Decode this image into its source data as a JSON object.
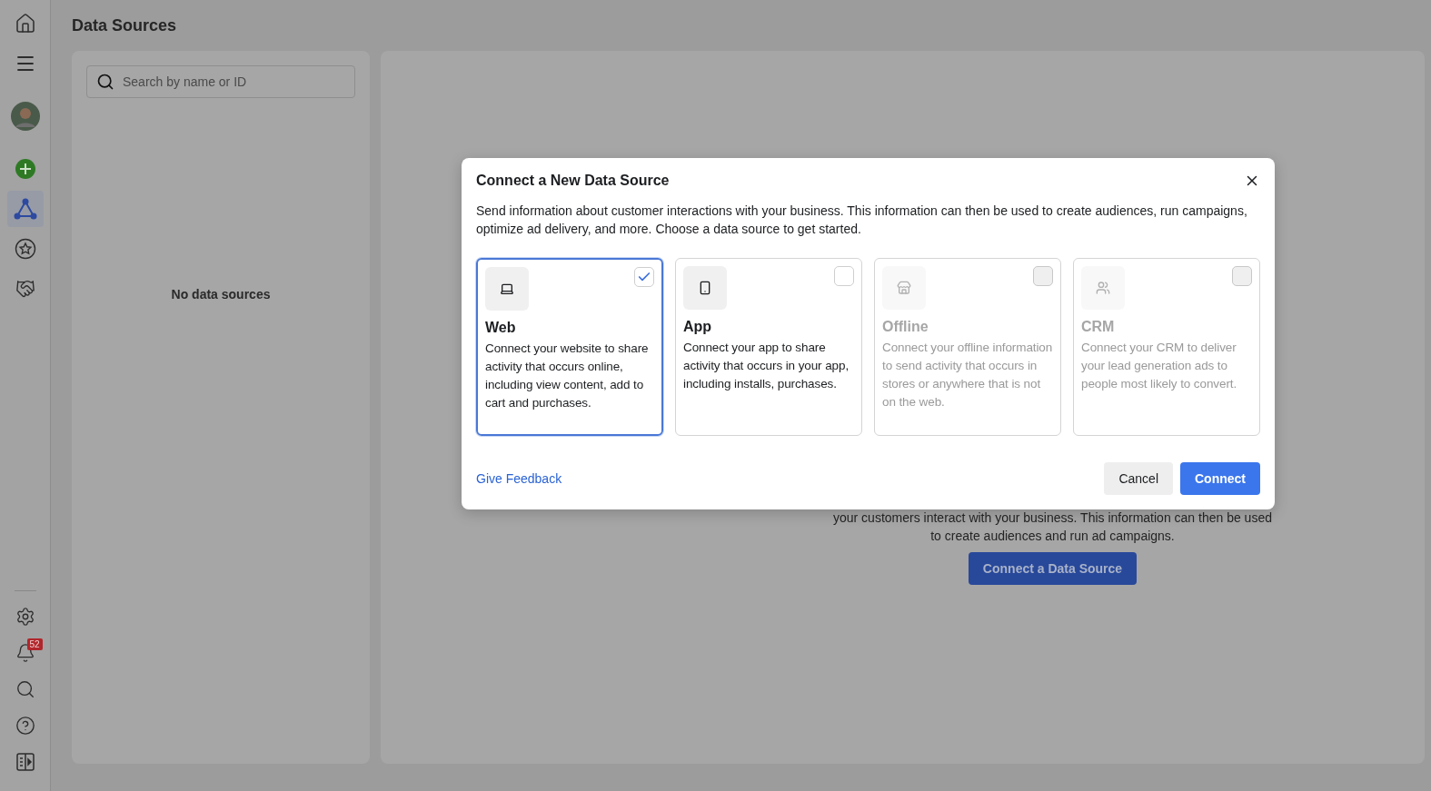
{
  "sidebar": {
    "items": [
      {
        "kind": "home",
        "selected": false
      },
      {
        "kind": "menu",
        "selected": false
      },
      {
        "kind": "avatar",
        "selected": false
      },
      {
        "kind": "create",
        "selected": false
      },
      {
        "kind": "data-sources",
        "selected": true
      },
      {
        "kind": "favorites",
        "selected": false
      },
      {
        "kind": "partners",
        "selected": false
      }
    ],
    "bottom_items": [
      {
        "kind": "settings"
      },
      {
        "kind": "notifications",
        "badge": "52"
      },
      {
        "kind": "search"
      },
      {
        "kind": "help"
      },
      {
        "kind": "panel"
      }
    ]
  },
  "page": {
    "title": "Data Sources"
  },
  "list_panel": {
    "search": {
      "placeholder": "Search by name or ID"
    },
    "empty_text": "No data sources"
  },
  "main_panel": {
    "description": [
      "your customers interact with your business. This information can then be used",
      "to create audiences and run ad campaigns."
    ],
    "button": "Connect a Data Source"
  },
  "dialog": {
    "title": "Connect a New Data Source",
    "intro": "Send information about customer interactions with your business. This information can then be used to create audiences, run campaigns, optimize ad delivery, and more. Choose a data source to get started.",
    "options": [
      {
        "kind": "web",
        "title": "Web",
        "description": "Connect your website to share activity that occurs online, including view content, add to cart and purchases.",
        "selected": true,
        "disabled": false
      },
      {
        "kind": "app",
        "title": "App",
        "description": "Connect your app to share activity that occurs in your app, including installs, purchases.",
        "selected": false,
        "disabled": false
      },
      {
        "kind": "offline",
        "title": "Offline",
        "description": "Connect your offline information to send activity that occurs in stores or anywhere that is not on the web.",
        "selected": false,
        "disabled": true
      },
      {
        "kind": "crm",
        "title": "CRM",
        "description": "Connect your CRM to deliver your lead generation ads to people most likely to convert.",
        "selected": false,
        "disabled": true
      }
    ],
    "feedback_link": "Give Feedback",
    "buttons": [
      {
        "kind": "secondary",
        "label": "Cancel"
      },
      {
        "kind": "primary",
        "label": "Connect"
      }
    ]
  }
}
